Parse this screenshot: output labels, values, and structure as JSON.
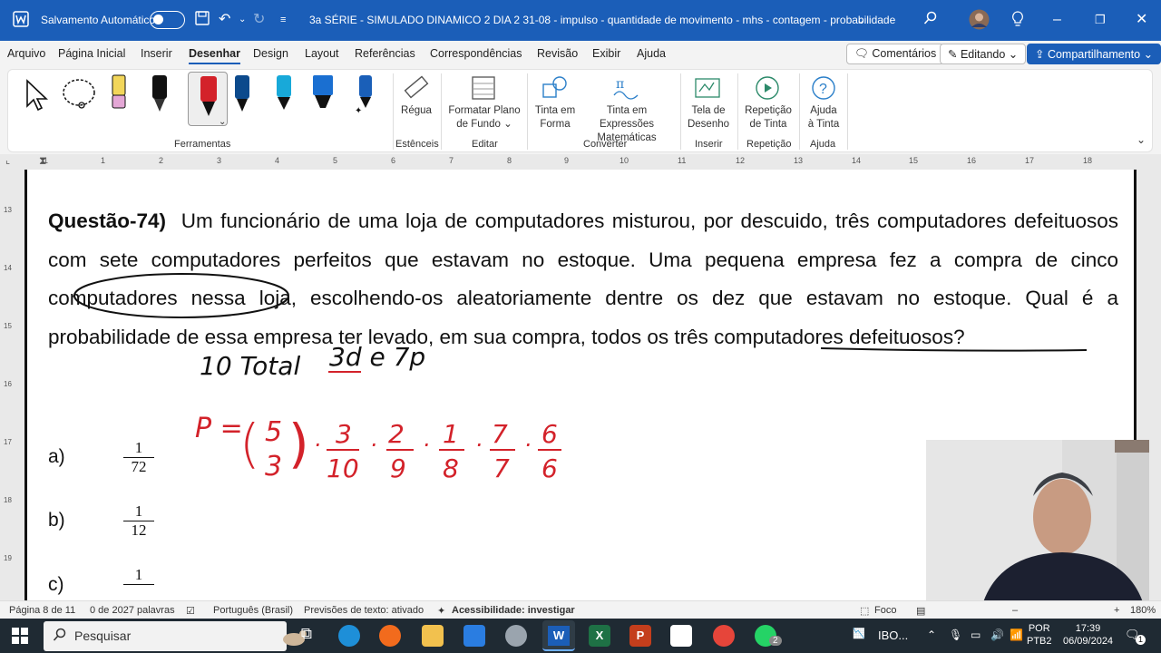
{
  "titlebar": {
    "autosave_label": "Salvamento Automático",
    "doc_title": "3a SÉRIE - SIMULADO DINAMICO  2 DIA 2 31-08 - impulso - quantidade de movimento - mhs - contagem - probabilidade",
    "brand_color": "#1b5eb8"
  },
  "menu": {
    "items": [
      "Arquivo",
      "Página Inicial",
      "Inserir",
      "Desenhar",
      "Design",
      "Layout",
      "Referências",
      "Correspondências",
      "Revisão",
      "Exibir",
      "Ajuda"
    ],
    "active": "Desenhar",
    "comments_label": "Comentários",
    "editing_label": "Editando",
    "share_label": "Compartilhamento"
  },
  "ribbon": {
    "groups": {
      "ferramentas": "Ferramentas",
      "estencis": "Estênceis",
      "editar": "Editar",
      "converter": "Converter",
      "inserir": "Inserir",
      "repeticao": "Repetição",
      "ajuda": "Ajuda"
    },
    "buttons": {
      "regua": "Régua",
      "formatar_1": "Formatar Plano",
      "formatar_2": "de Fundo",
      "tinta_forma_1": "Tinta em",
      "tinta_forma_2": "Forma",
      "tinta_expr_1": "Tinta em Expressões",
      "tinta_expr_2": "Matemáticas",
      "tela_1": "Tela de",
      "tela_2": "Desenho",
      "rep_1": "Repetição",
      "rep_2": "de Tinta",
      "ajuda_1": "Ajuda",
      "ajuda_2": "à Tinta"
    }
  },
  "ruler": {
    "numbers": [
      "1",
      "1",
      "2",
      "3",
      "4",
      "5",
      "6",
      "7",
      "8",
      "9",
      "10",
      "11",
      "12",
      "13",
      "14",
      "15",
      "16",
      "17",
      "18"
    ],
    "vertical_numbers": [
      "13",
      "14",
      "15",
      "16",
      "17",
      "18",
      "19"
    ]
  },
  "document": {
    "question_label": "Questão-74)",
    "question_text": "Um funcionário de uma loja de computadores misturou, por descuido, três computadores defeituosos com sete computadores perfeitos que estavam no estoque. Uma pequena empresa fez a compra de cinco computadores nessa loja, escolhendo-os aleatoriamente dentre os dez que estavam no estoque. Qual é a probabilidade de essa empresa ter levado, em sua compra, todos os três computadores defeituosos?",
    "options": [
      {
        "letter": "a)",
        "num": "1",
        "den": "72"
      },
      {
        "letter": "b)",
        "num": "1",
        "den": "12"
      },
      {
        "letter": "c)",
        "num": "1",
        "den": ""
      }
    ],
    "handwriting": {
      "note1": "10 Total",
      "note2": "3d e 7p",
      "formula_p": "P =",
      "binom_top": "5",
      "binom_bottom": "3",
      "fractions": [
        {
          "num": "3",
          "den": "10"
        },
        {
          "num": "2",
          "den": "9"
        },
        {
          "num": "1",
          "den": "8"
        },
        {
          "num": "7",
          "den": "7"
        },
        {
          "num": "6",
          "den": "6"
        }
      ],
      "ink_black": "#111111",
      "ink_red": "#d3222a"
    }
  },
  "statusbar": {
    "page": "Página 8 de 11",
    "words": "0 de 2027 palavras",
    "language": "Português (Brasil)",
    "predictions": "Previsões de texto: ativado",
    "accessibility": "Acessibilidade: investigar",
    "focus": "Foco",
    "zoom": "180%"
  },
  "taskbar": {
    "search_placeholder": "Pesquisar",
    "ibov": "IBO...",
    "lang_1": "POR",
    "lang_2": "PTB2",
    "time": "17:39",
    "date": "06/09/2024",
    "whatsapp_badge": "2",
    "notif_badge": "1"
  }
}
